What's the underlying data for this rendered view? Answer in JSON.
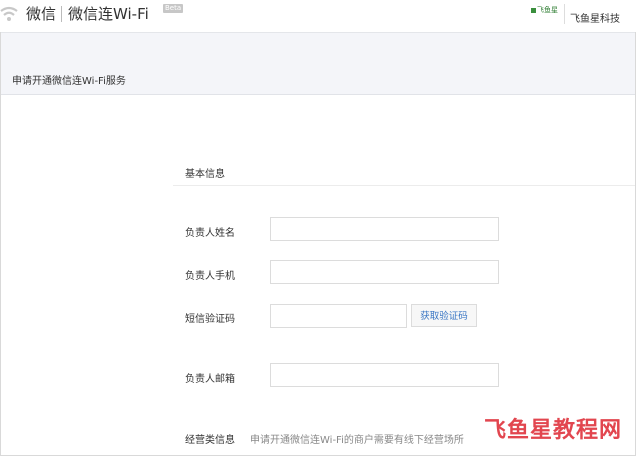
{
  "header": {
    "brand": "微信",
    "product": "微信连Wi-Fi",
    "beta_badge": "Beta",
    "account_logo_text": "飞鱼星",
    "account_name": "飞鱼星科技"
  },
  "breadcrumb": {
    "title": "申请开通微信连Wi-Fi服务"
  },
  "form": {
    "section_title": "基本信息",
    "name_label": "负责人姓名",
    "name_value": "",
    "phone_label": "负责人手机",
    "phone_value": "",
    "sms_label": "短信验证码",
    "sms_value": "",
    "get_code_button": "获取验证码",
    "email_label": "负责人邮箱",
    "email_value": "",
    "business_label": "经营类信息",
    "business_desc": "申请开通微信连Wi-Fi的商户需要有线下经营场所"
  },
  "watermark": "飞鱼星教程网",
  "colors": {
    "link_blue": "#3976c4",
    "watermark_red": "#e2464f",
    "nav_bg": "#f4f5f9"
  },
  "icons": {
    "logo": "wechat-wave-logo-icon",
    "account": "feiyuxing-logo-icon"
  }
}
